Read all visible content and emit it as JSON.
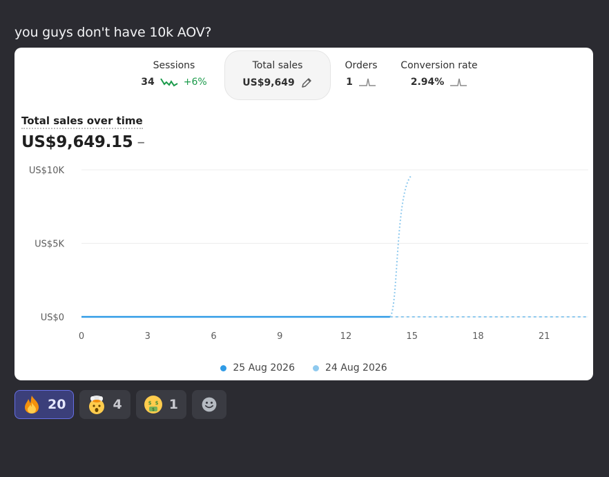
{
  "message": {
    "text": "you guys don't have 10k AOV?"
  },
  "metrics": [
    {
      "label": "Sessions",
      "value": "34",
      "change": "+6%",
      "icon": "sparkline-down-icon"
    },
    {
      "label": "Total sales",
      "value": "US$9,649",
      "icon": "pencil-icon",
      "selected": true
    },
    {
      "label": "Orders",
      "value": "1",
      "icon": "sparkline-spike-icon"
    },
    {
      "label": "Conversion rate",
      "value": "2.94%",
      "icon": "sparkline-spike-icon"
    }
  ],
  "chart_header": {
    "title": "Total sales over time",
    "total": "US$9,649.15",
    "change": "–"
  },
  "chart_data": {
    "type": "line",
    "ylim": [
      0,
      10000
    ],
    "y_ticks": [
      "US$0",
      "US$5K",
      "US$10K"
    ],
    "x_ticks": [
      "0",
      "3",
      "6",
      "9",
      "12",
      "15",
      "18",
      "21"
    ],
    "xlim": [
      0,
      23
    ],
    "series": [
      {
        "name": "25 Aug 2026",
        "color": "#2f9be6",
        "style": "solid",
        "x": [
          0,
          1,
          2,
          3,
          4,
          5,
          6,
          7,
          8,
          9,
          10,
          11,
          12,
          13,
          14
        ],
        "y": [
          0,
          0,
          0,
          0,
          0,
          0,
          0,
          0,
          0,
          0,
          0,
          0,
          0,
          0,
          0
        ]
      },
      {
        "name": "24 Aug 2026",
        "color": "#8ec9ee",
        "style": "dotted",
        "x": [
          14,
          15,
          16,
          17,
          18,
          19,
          20,
          21,
          22,
          23
        ],
        "y": [
          0,
          0,
          0,
          0,
          0,
          0,
          0,
          0,
          0,
          0
        ],
        "spike": {
          "x": 14,
          "to_x": 15,
          "y": 9649
        }
      }
    ]
  },
  "legend": [
    {
      "label": "25 Aug 2026",
      "color": "#2f9be6"
    },
    {
      "label": "24 Aug 2026",
      "color": "#8ec9ee"
    }
  ],
  "reactions": [
    {
      "emoji": "fire",
      "count": "20",
      "active": true
    },
    {
      "emoji": "exploding-head",
      "count": "4",
      "active": false
    },
    {
      "emoji": "money-mouth",
      "count": "1",
      "active": false
    }
  ]
}
